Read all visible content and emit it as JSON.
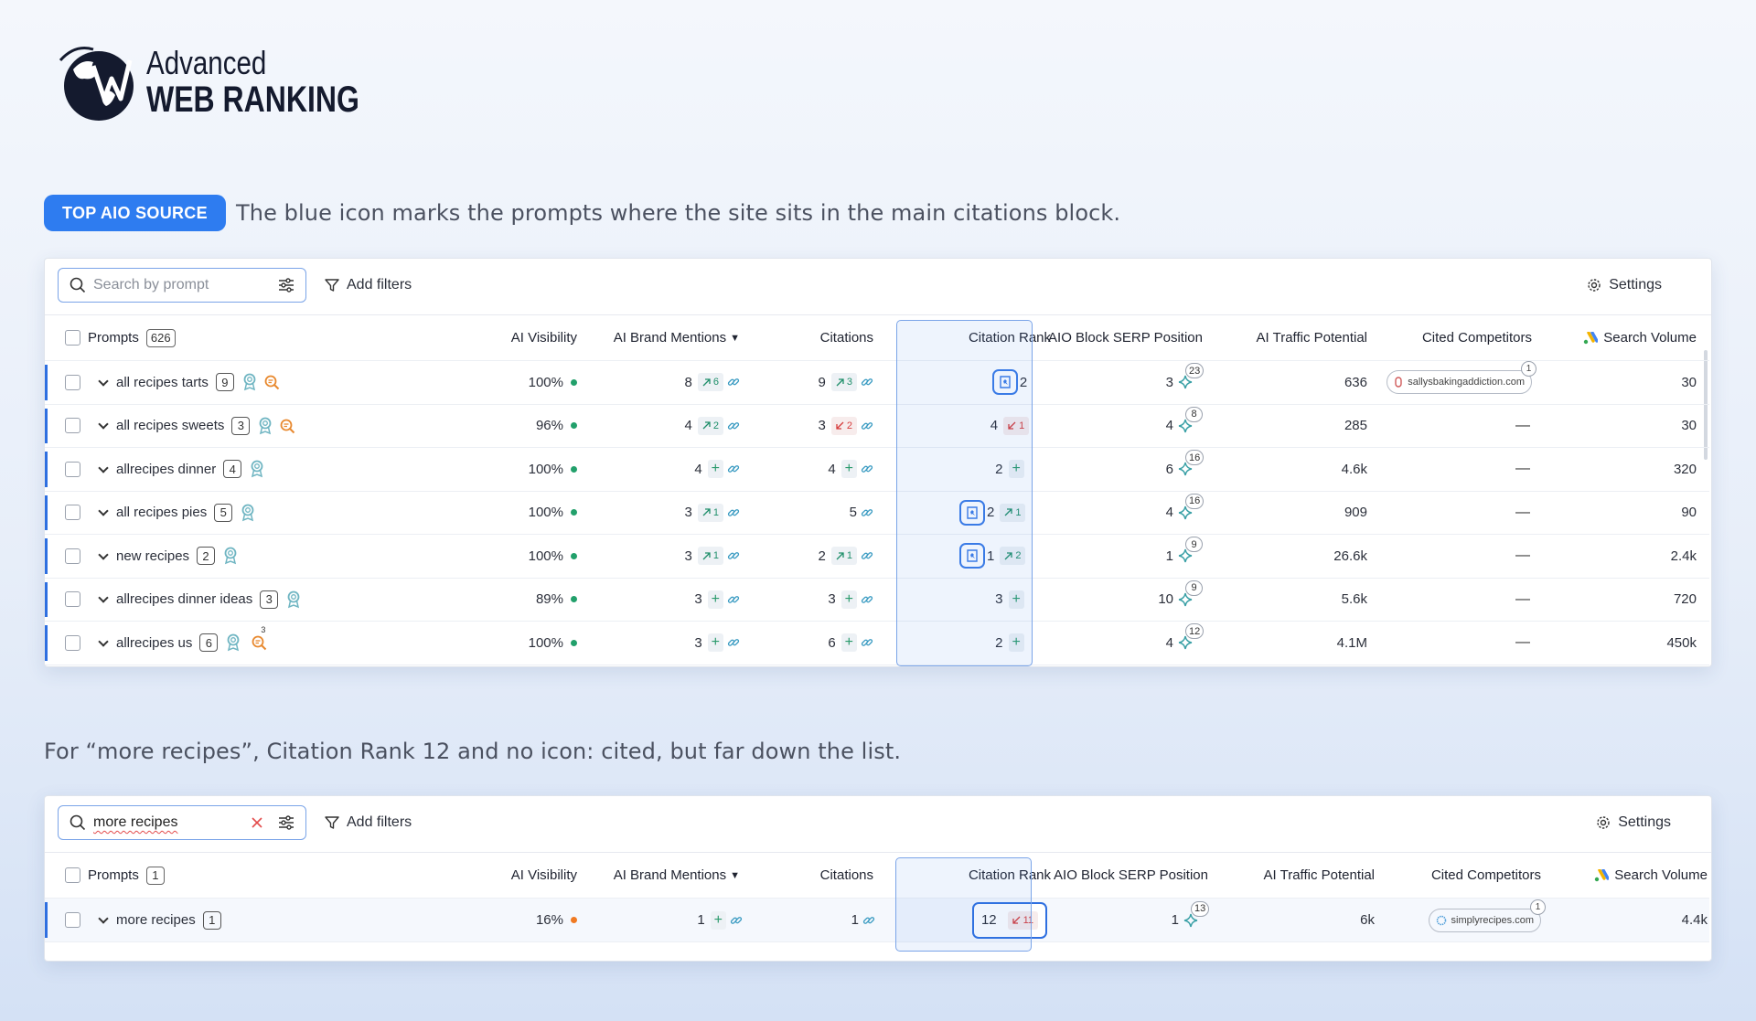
{
  "logo": {
    "line1": "Advanced",
    "line2": "WEB RANKING"
  },
  "badge": "TOP AIO SOURCE",
  "caption1": "The blue icon marks the prompts where the site sits in the main citations block.",
  "caption2": "For “more recipes”, Citation Rank 12 and no icon: cited, but far down the list.",
  "toolbar": {
    "search_placeholder": "Search by prompt",
    "search_value": "more recipes",
    "add_filters": "Add filters",
    "settings": "Settings"
  },
  "columns": {
    "prompts": "Prompts",
    "ai_visibility": "AI Visibility",
    "ai_brand_mentions": "AI Brand Mentions",
    "citations": "Citations",
    "citation_rank": "Citation Rank",
    "aio_block_serp": "AIO Block SERP Position",
    "ai_traffic": "AI Traffic Potential",
    "cited_competitors": "Cited Competitors",
    "search_volume": "Search Volume"
  },
  "table1": {
    "prompt_count": "626",
    "rows": [
      {
        "prompt": "all recipes tarts",
        "count": "9",
        "visibility": "100%",
        "mentions": "8",
        "mentions_delta": "6",
        "citations": "9",
        "citations_delta": "3",
        "rank": "2",
        "aio_pos": "3",
        "aio_count": "23",
        "traffic": "636",
        "competitor": "sallysbakingaddiction.com",
        "competitor_count": "1",
        "volume": "30"
      },
      {
        "prompt": "all recipes sweets",
        "count": "3",
        "visibility": "96%",
        "mentions": "4",
        "mentions_delta": "2",
        "citations": "3",
        "citations_delta": "2",
        "rank": "4",
        "rank_delta": "1",
        "aio_pos": "4",
        "aio_count": "8",
        "traffic": "285",
        "competitor": "—",
        "volume": "30"
      },
      {
        "prompt": "allrecipes dinner",
        "count": "4",
        "visibility": "100%",
        "mentions": "4",
        "citations": "4",
        "rank": "2",
        "aio_pos": "6",
        "aio_count": "16",
        "traffic": "4.6k",
        "competitor": "—",
        "volume": "320"
      },
      {
        "prompt": "all recipes pies",
        "count": "5",
        "visibility": "100%",
        "mentions": "3",
        "mentions_delta": "1",
        "citations": "5",
        "rank": "2",
        "rank_delta": "1",
        "aio_pos": "4",
        "aio_count": "16",
        "traffic": "909",
        "competitor": "—",
        "volume": "90"
      },
      {
        "prompt": "new recipes",
        "count": "2",
        "visibility": "100%",
        "mentions": "3",
        "mentions_delta": "1",
        "citations": "2",
        "citations_delta": "1",
        "rank": "1",
        "rank_delta": "2",
        "aio_pos": "1",
        "aio_count": "9",
        "traffic": "26.6k",
        "competitor": "—",
        "volume": "2.4k"
      },
      {
        "prompt": "allrecipes dinner ideas",
        "count": "3",
        "visibility": "89%",
        "mentions": "3",
        "citations": "3",
        "rank": "3",
        "aio_pos": "10",
        "aio_count": "9",
        "traffic": "5.6k",
        "competitor": "—",
        "volume": "720"
      },
      {
        "prompt": "allrecipes us",
        "count": "6",
        "visibility": "100%",
        "mentions": "3",
        "citations": "6",
        "rank": "2",
        "aio_pos": "4",
        "aio_count": "12",
        "traffic": "4.1M",
        "competitor": "—",
        "volume": "450k",
        "search_badge": "3"
      }
    ]
  },
  "table2": {
    "prompt_count": "1",
    "row": {
      "prompt": "more recipes",
      "count": "1",
      "visibility": "16%",
      "mentions": "1",
      "citations": "1",
      "rank": "12",
      "rank_delta": "11",
      "aio_pos": "1",
      "aio_count": "13",
      "traffic": "6k",
      "competitor": "simplyrecipes.com",
      "competitor_count": "1",
      "volume": "4.4k"
    }
  },
  "colors": {
    "accent": "#2e7cf0",
    "green": "#22a06b",
    "orange": "#f07a22",
    "red": "#d63b3b"
  }
}
